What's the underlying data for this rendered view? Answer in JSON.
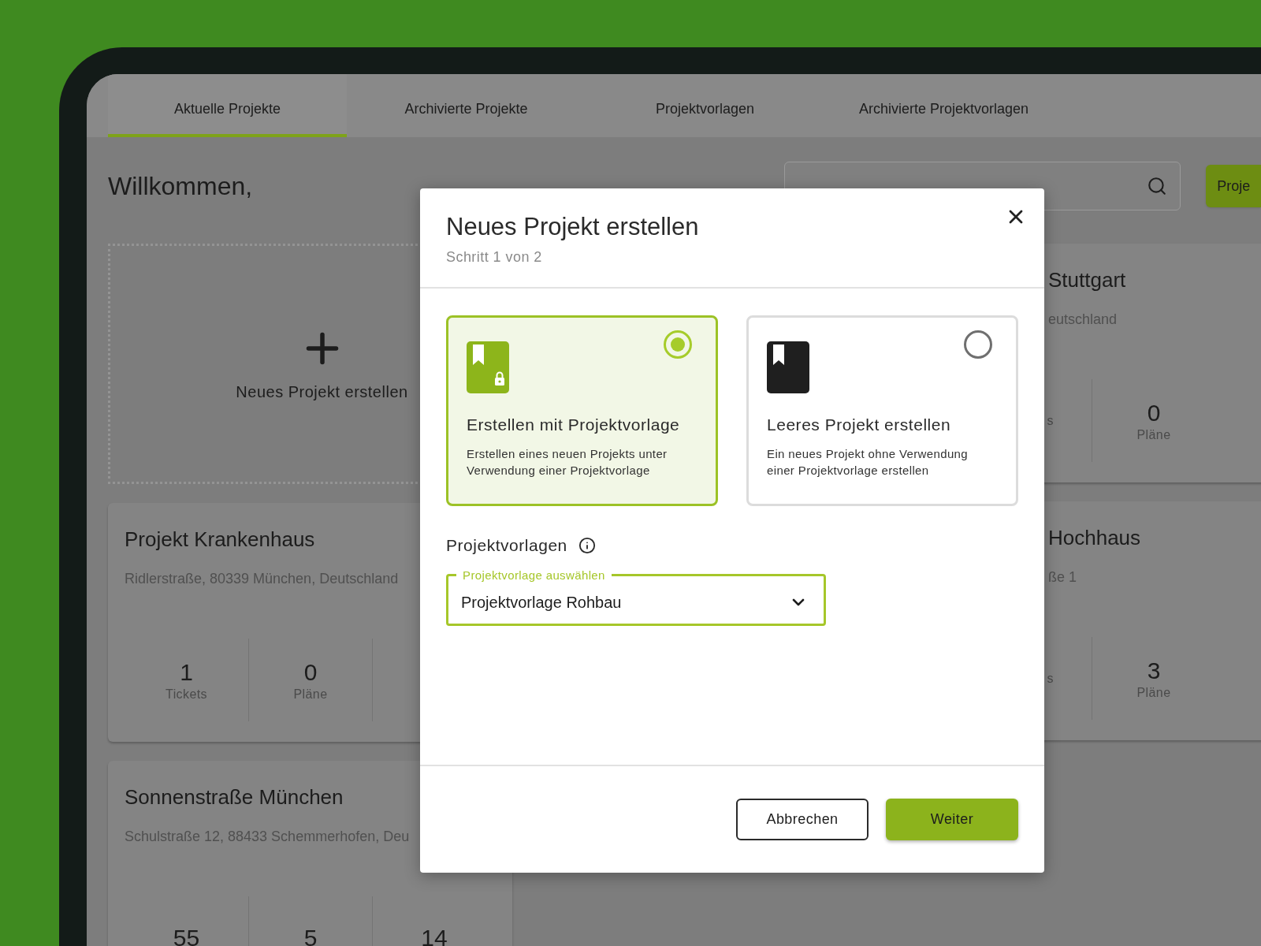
{
  "tabs": [
    {
      "label": "Aktuelle Projekte",
      "selected": true
    },
    {
      "label": "Archivierte Projekte",
      "selected": false
    },
    {
      "label": "Projektvorlagen",
      "selected": false
    },
    {
      "label": "Archivierte Projektvorlagen",
      "selected": false
    }
  ],
  "greeting": "Willkommen,",
  "create_button": "Proje",
  "new_project_tile": {
    "label": "Neues Projekt erstellen"
  },
  "project_cards_left": [
    {
      "title": "Projekt Krankenhaus",
      "address": "Ridlerstraße, 80339 München, Deutschland",
      "stats": [
        {
          "value": "1",
          "label": "Tickets"
        },
        {
          "value": "0",
          "label": "Pläne"
        }
      ]
    },
    {
      "title": "Sonnenstraße München",
      "address": "Schulstraße 12, 88433 Schemmerhofen, Deu",
      "stats": [
        {
          "value": "55"
        },
        {
          "value": "5"
        },
        {
          "value": "14"
        }
      ]
    }
  ],
  "project_cards_right": [
    {
      "title": "Stuttgart",
      "address": "eutschland",
      "stats": [
        {
          "label": "s"
        },
        {
          "value": "0",
          "label": "Pläne"
        }
      ]
    },
    {
      "title": "Hochhaus",
      "address": "ße 1",
      "stats": [
        {
          "label": "s"
        },
        {
          "value": "3",
          "label": "Pläne"
        }
      ]
    }
  ],
  "dialog": {
    "title": "Neues Projekt erstellen",
    "step": "Schritt 1 von 2",
    "options": [
      {
        "kind": "template",
        "title": "Erstellen mit Projektvorlage",
        "description": "Erstellen eines neuen Projekts unter Verwendung einer Projektvorlage",
        "selected": true
      },
      {
        "kind": "blank",
        "title": "Leeres Projekt erstellen",
        "description": "Ein neues Projekt ohne Verwendung einer Projektvorlage erstellen",
        "selected": false
      }
    ],
    "section_label": "Projektvorlagen",
    "select": {
      "label": "Projektvorlage auswählen",
      "value": "Projektvorlage Rohbau"
    },
    "buttons": [
      {
        "kind": "secondary",
        "label": "Abbrechen"
      },
      {
        "kind": "primary",
        "label": "Weiter"
      }
    ]
  }
}
